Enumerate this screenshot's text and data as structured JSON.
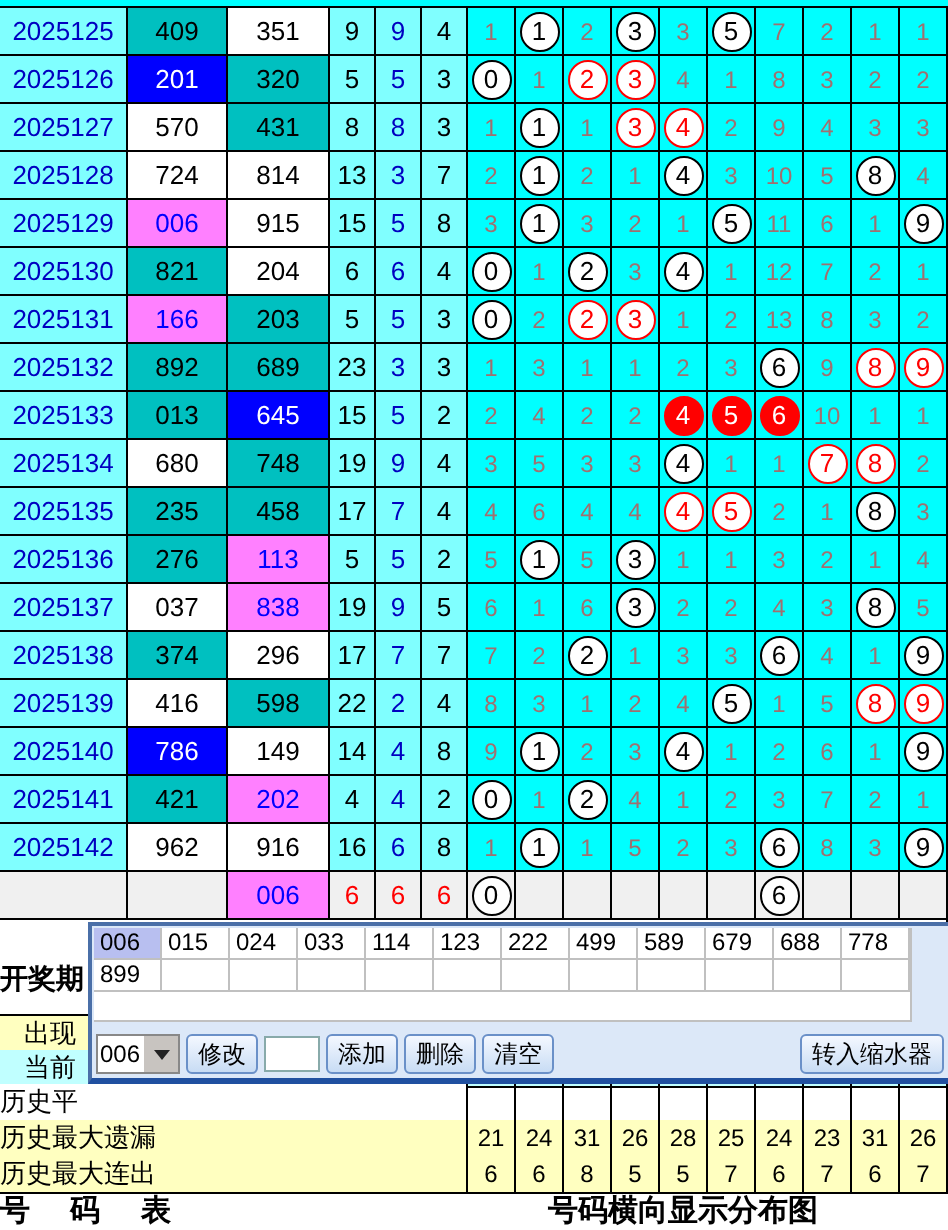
{
  "draws": [
    {
      "period": "2025125",
      "number_1": {
        "text": "409",
        "color": "#00c0c0"
      },
      "number_2": {
        "text": "351",
        "color": "#ffffff"
      },
      "sum": "9",
      "sum_tail": "9",
      "span": "4",
      "digits": [
        {
          "text": "1",
          "kind": "miss"
        },
        {
          "text": "1",
          "kind": "ball"
        },
        {
          "text": "2",
          "kind": "miss"
        },
        {
          "text": "3",
          "kind": "ball"
        },
        {
          "text": "3",
          "kind": "miss"
        },
        {
          "text": "5",
          "kind": "ball"
        },
        {
          "text": "7",
          "kind": "miss"
        },
        {
          "text": "2",
          "kind": "miss"
        },
        {
          "text": "1",
          "kind": "miss"
        },
        {
          "text": "1",
          "kind": "miss"
        }
      ]
    },
    {
      "period": "2025126",
      "number_1": {
        "text": "201",
        "color": "#0000ff"
      },
      "number_2": {
        "text": "320",
        "color": "#00c0c0"
      },
      "sum": "5",
      "sum_tail": "5",
      "span": "3",
      "digits": [
        {
          "text": "0",
          "kind": "ball"
        },
        {
          "text": "1",
          "kind": "miss"
        },
        {
          "text": "2",
          "kind": "ring"
        },
        {
          "text": "3",
          "kind": "ring"
        },
        {
          "text": "4",
          "kind": "miss"
        },
        {
          "text": "1",
          "kind": "miss"
        },
        {
          "text": "8",
          "kind": "miss"
        },
        {
          "text": "3",
          "kind": "miss"
        },
        {
          "text": "2",
          "kind": "miss"
        },
        {
          "text": "2",
          "kind": "miss"
        }
      ]
    },
    {
      "period": "2025127",
      "number_1": {
        "text": "570",
        "color": "#ffffff"
      },
      "number_2": {
        "text": "431",
        "color": "#00c0c0"
      },
      "sum": "8",
      "sum_tail": "8",
      "span": "3",
      "digits": [
        {
          "text": "1",
          "kind": "miss"
        },
        {
          "text": "1",
          "kind": "ball"
        },
        {
          "text": "1",
          "kind": "miss"
        },
        {
          "text": "3",
          "kind": "ring"
        },
        {
          "text": "4",
          "kind": "ring"
        },
        {
          "text": "2",
          "kind": "miss"
        },
        {
          "text": "9",
          "kind": "miss"
        },
        {
          "text": "4",
          "kind": "miss"
        },
        {
          "text": "3",
          "kind": "miss"
        },
        {
          "text": "3",
          "kind": "miss"
        }
      ]
    },
    {
      "period": "2025128",
      "number_1": {
        "text": "724",
        "color": "#ffffff"
      },
      "number_2": {
        "text": "814",
        "color": "#ffffff"
      },
      "sum": "13",
      "sum_tail": "3",
      "span": "7",
      "digits": [
        {
          "text": "2",
          "kind": "miss"
        },
        {
          "text": "1",
          "kind": "ball"
        },
        {
          "text": "2",
          "kind": "miss"
        },
        {
          "text": "1",
          "kind": "miss"
        },
        {
          "text": "4",
          "kind": "ball"
        },
        {
          "text": "3",
          "kind": "miss"
        },
        {
          "text": "10",
          "kind": "miss"
        },
        {
          "text": "5",
          "kind": "miss"
        },
        {
          "text": "8",
          "kind": "ball"
        },
        {
          "text": "4",
          "kind": "miss"
        }
      ]
    },
    {
      "period": "2025129",
      "number_1": {
        "text": "006",
        "color": "#ff80ff"
      },
      "number_2": {
        "text": "915",
        "color": "#ffffff"
      },
      "sum": "15",
      "sum_tail": "5",
      "span": "8",
      "digits": [
        {
          "text": "3",
          "kind": "miss"
        },
        {
          "text": "1",
          "kind": "ball"
        },
        {
          "text": "3",
          "kind": "miss"
        },
        {
          "text": "2",
          "kind": "miss"
        },
        {
          "text": "1",
          "kind": "miss"
        },
        {
          "text": "5",
          "kind": "ball"
        },
        {
          "text": "11",
          "kind": "miss"
        },
        {
          "text": "6",
          "kind": "miss"
        },
        {
          "text": "1",
          "kind": "miss"
        },
        {
          "text": "9",
          "kind": "ball"
        }
      ]
    },
    {
      "period": "2025130",
      "number_1": {
        "text": "821",
        "color": "#00c0c0"
      },
      "number_2": {
        "text": "204",
        "color": "#ffffff"
      },
      "sum": "6",
      "sum_tail": "6",
      "span": "4",
      "digits": [
        {
          "text": "0",
          "kind": "ball"
        },
        {
          "text": "1",
          "kind": "miss"
        },
        {
          "text": "2",
          "kind": "ball"
        },
        {
          "text": "3",
          "kind": "miss"
        },
        {
          "text": "4",
          "kind": "ball"
        },
        {
          "text": "1",
          "kind": "miss"
        },
        {
          "text": "12",
          "kind": "miss"
        },
        {
          "text": "7",
          "kind": "miss"
        },
        {
          "text": "2",
          "kind": "miss"
        },
        {
          "text": "1",
          "kind": "miss"
        }
      ]
    },
    {
      "period": "2025131",
      "number_1": {
        "text": "166",
        "color": "#ff80ff"
      },
      "number_2": {
        "text": "203",
        "color": "#00c0c0"
      },
      "sum": "5",
      "sum_tail": "5",
      "span": "3",
      "digits": [
        {
          "text": "0",
          "kind": "ball"
        },
        {
          "text": "2",
          "kind": "miss"
        },
        {
          "text": "2",
          "kind": "ring"
        },
        {
          "text": "3",
          "kind": "ring"
        },
        {
          "text": "1",
          "kind": "miss"
        },
        {
          "text": "2",
          "kind": "miss"
        },
        {
          "text": "13",
          "kind": "miss"
        },
        {
          "text": "8",
          "kind": "miss"
        },
        {
          "text": "3",
          "kind": "miss"
        },
        {
          "text": "2",
          "kind": "miss"
        }
      ]
    },
    {
      "period": "2025132",
      "number_1": {
        "text": "892",
        "color": "#00c0c0"
      },
      "number_2": {
        "text": "689",
        "color": "#00c0c0"
      },
      "sum": "23",
      "sum_tail": "3",
      "span": "3",
      "digits": [
        {
          "text": "1",
          "kind": "miss"
        },
        {
          "text": "3",
          "kind": "miss"
        },
        {
          "text": "1",
          "kind": "miss"
        },
        {
          "text": "1",
          "kind": "miss"
        },
        {
          "text": "2",
          "kind": "miss"
        },
        {
          "text": "3",
          "kind": "miss"
        },
        {
          "text": "6",
          "kind": "ball"
        },
        {
          "text": "9",
          "kind": "miss"
        },
        {
          "text": "8",
          "kind": "ring"
        },
        {
          "text": "9",
          "kind": "ring"
        }
      ]
    },
    {
      "period": "2025133",
      "number_1": {
        "text": "013",
        "color": "#00c0c0"
      },
      "number_2": {
        "text": "645",
        "color": "#0000ff"
      },
      "sum": "15",
      "sum_tail": "5",
      "span": "2",
      "digits": [
        {
          "text": "2",
          "kind": "miss"
        },
        {
          "text": "4",
          "kind": "miss"
        },
        {
          "text": "2",
          "kind": "miss"
        },
        {
          "text": "2",
          "kind": "miss"
        },
        {
          "text": "4",
          "kind": "hot"
        },
        {
          "text": "5",
          "kind": "hot"
        },
        {
          "text": "6",
          "kind": "hot"
        },
        {
          "text": "10",
          "kind": "miss"
        },
        {
          "text": "1",
          "kind": "miss"
        },
        {
          "text": "1",
          "kind": "miss"
        }
      ]
    },
    {
      "period": "2025134",
      "number_1": {
        "text": "680",
        "color": "#ffffff"
      },
      "number_2": {
        "text": "748",
        "color": "#00c0c0"
      },
      "sum": "19",
      "sum_tail": "9",
      "span": "4",
      "digits": [
        {
          "text": "3",
          "kind": "miss"
        },
        {
          "text": "5",
          "kind": "miss"
        },
        {
          "text": "3",
          "kind": "miss"
        },
        {
          "text": "3",
          "kind": "miss"
        },
        {
          "text": "4",
          "kind": "ball"
        },
        {
          "text": "1",
          "kind": "miss"
        },
        {
          "text": "1",
          "kind": "miss"
        },
        {
          "text": "7",
          "kind": "ring"
        },
        {
          "text": "8",
          "kind": "ring"
        },
        {
          "text": "2",
          "kind": "miss"
        }
      ]
    },
    {
      "period": "2025135",
      "number_1": {
        "text": "235",
        "color": "#00c0c0"
      },
      "number_2": {
        "text": "458",
        "color": "#00c0c0"
      },
      "sum": "17",
      "sum_tail": "7",
      "span": "4",
      "digits": [
        {
          "text": "4",
          "kind": "miss"
        },
        {
          "text": "6",
          "kind": "miss"
        },
        {
          "text": "4",
          "kind": "miss"
        },
        {
          "text": "4",
          "kind": "miss"
        },
        {
          "text": "4",
          "kind": "ring"
        },
        {
          "text": "5",
          "kind": "ring"
        },
        {
          "text": "2",
          "kind": "miss"
        },
        {
          "text": "1",
          "kind": "miss"
        },
        {
          "text": "8",
          "kind": "ball"
        },
        {
          "text": "3",
          "kind": "miss"
        }
      ]
    },
    {
      "period": "2025136",
      "number_1": {
        "text": "276",
        "color": "#00c0c0"
      },
      "number_2": {
        "text": "113",
        "color": "#ff80ff"
      },
      "sum": "5",
      "sum_tail": "5",
      "span": "2",
      "digits": [
        {
          "text": "5",
          "kind": "miss"
        },
        {
          "text": "1",
          "kind": "ball"
        },
        {
          "text": "5",
          "kind": "miss"
        },
        {
          "text": "3",
          "kind": "ball"
        },
        {
          "text": "1",
          "kind": "miss"
        },
        {
          "text": "1",
          "kind": "miss"
        },
        {
          "text": "3",
          "kind": "miss"
        },
        {
          "text": "2",
          "kind": "miss"
        },
        {
          "text": "1",
          "kind": "miss"
        },
        {
          "text": "4",
          "kind": "miss"
        }
      ]
    },
    {
      "period": "2025137",
      "number_1": {
        "text": "037",
        "color": "#ffffff"
      },
      "number_2": {
        "text": "838",
        "color": "#ff80ff"
      },
      "sum": "19",
      "sum_tail": "9",
      "span": "5",
      "digits": [
        {
          "text": "6",
          "kind": "miss"
        },
        {
          "text": "1",
          "kind": "miss"
        },
        {
          "text": "6",
          "kind": "miss"
        },
        {
          "text": "3",
          "kind": "ball"
        },
        {
          "text": "2",
          "kind": "miss"
        },
        {
          "text": "2",
          "kind": "miss"
        },
        {
          "text": "4",
          "kind": "miss"
        },
        {
          "text": "3",
          "kind": "miss"
        },
        {
          "text": "8",
          "kind": "ball"
        },
        {
          "text": "5",
          "kind": "miss"
        }
      ]
    },
    {
      "period": "2025138",
      "number_1": {
        "text": "374",
        "color": "#00c0c0"
      },
      "number_2": {
        "text": "296",
        "color": "#ffffff"
      },
      "sum": "17",
      "sum_tail": "7",
      "span": "7",
      "digits": [
        {
          "text": "7",
          "kind": "miss"
        },
        {
          "text": "2",
          "kind": "miss"
        },
        {
          "text": "2",
          "kind": "ball"
        },
        {
          "text": "1",
          "kind": "miss"
        },
        {
          "text": "3",
          "kind": "miss"
        },
        {
          "text": "3",
          "kind": "miss"
        },
        {
          "text": "6",
          "kind": "ball"
        },
        {
          "text": "4",
          "kind": "miss"
        },
        {
          "text": "1",
          "kind": "miss"
        },
        {
          "text": "9",
          "kind": "ball"
        }
      ]
    },
    {
      "period": "2025139",
      "number_1": {
        "text": "416",
        "color": "#ffffff"
      },
      "number_2": {
        "text": "598",
        "color": "#00c0c0"
      },
      "sum": "22",
      "sum_tail": "2",
      "span": "4",
      "digits": [
        {
          "text": "8",
          "kind": "miss"
        },
        {
          "text": "3",
          "kind": "miss"
        },
        {
          "text": "1",
          "kind": "miss"
        },
        {
          "text": "2",
          "kind": "miss"
        },
        {
          "text": "4",
          "kind": "miss"
        },
        {
          "text": "5",
          "kind": "ball"
        },
        {
          "text": "1",
          "kind": "miss"
        },
        {
          "text": "5",
          "kind": "miss"
        },
        {
          "text": "8",
          "kind": "ring"
        },
        {
          "text": "9",
          "kind": "ring"
        }
      ]
    },
    {
      "period": "2025140",
      "number_1": {
        "text": "786",
        "color": "#0000ff"
      },
      "number_2": {
        "text": "149",
        "color": "#ffffff"
      },
      "sum": "14",
      "sum_tail": "4",
      "span": "8",
      "digits": [
        {
          "text": "9",
          "kind": "miss"
        },
        {
          "text": "1",
          "kind": "ball"
        },
        {
          "text": "2",
          "kind": "miss"
        },
        {
          "text": "3",
          "kind": "miss"
        },
        {
          "text": "4",
          "kind": "ball"
        },
        {
          "text": "1",
          "kind": "miss"
        },
        {
          "text": "2",
          "kind": "miss"
        },
        {
          "text": "6",
          "kind": "miss"
        },
        {
          "text": "1",
          "kind": "miss"
        },
        {
          "text": "9",
          "kind": "ball"
        }
      ]
    },
    {
      "period": "2025141",
      "number_1": {
        "text": "421",
        "color": "#00c0c0"
      },
      "number_2": {
        "text": "202",
        "color": "#ff80ff"
      },
      "sum": "4",
      "sum_tail": "4",
      "span": "2",
      "digits": [
        {
          "text": "0",
          "kind": "ball"
        },
        {
          "text": "1",
          "kind": "miss"
        },
        {
          "text": "2",
          "kind": "ball"
        },
        {
          "text": "4",
          "kind": "miss"
        },
        {
          "text": "1",
          "kind": "miss"
        },
        {
          "text": "2",
          "kind": "miss"
        },
        {
          "text": "3",
          "kind": "miss"
        },
        {
          "text": "7",
          "kind": "miss"
        },
        {
          "text": "2",
          "kind": "miss"
        },
        {
          "text": "1",
          "kind": "miss"
        }
      ]
    },
    {
      "period": "2025142",
      "number_1": {
        "text": "962",
        "color": "#ffffff"
      },
      "number_2": {
        "text": "916",
        "color": "#ffffff"
      },
      "sum": "16",
      "sum_tail": "6",
      "span": "8",
      "digits": [
        {
          "text": "1",
          "kind": "miss"
        },
        {
          "text": "1",
          "kind": "ball"
        },
        {
          "text": "1",
          "kind": "miss"
        },
        {
          "text": "5",
          "kind": "miss"
        },
        {
          "text": "2",
          "kind": "miss"
        },
        {
          "text": "3",
          "kind": "miss"
        },
        {
          "text": "6",
          "kind": "ball"
        },
        {
          "text": "8",
          "kind": "miss"
        },
        {
          "text": "3",
          "kind": "miss"
        },
        {
          "text": "9",
          "kind": "ball"
        }
      ]
    }
  ],
  "summary": {
    "number_2": {
      "text": "006",
      "color": "#ff80ff"
    },
    "sum": "6",
    "sum_tail": "6",
    "span": "6",
    "digits": [
      {
        "text": "0",
        "kind": "ball"
      },
      {
        "kind": "empty"
      },
      {
        "kind": "empty"
      },
      {
        "kind": "empty"
      },
      {
        "kind": "empty"
      },
      {
        "kind": "empty"
      },
      {
        "text": "6",
        "kind": "ball"
      },
      {
        "kind": "empty"
      },
      {
        "kind": "empty"
      },
      {
        "kind": "empty"
      }
    ]
  },
  "stats_rows": [
    {
      "label": "开奖期",
      "kind": "header"
    },
    {
      "label": "出现",
      "kind": "indented",
      "color": "#ffffc0"
    },
    {
      "label": "当前",
      "kind": "indented",
      "color": "#c0ffff"
    },
    {
      "label": "历史平",
      "kind": "plain",
      "color": "#ffffff",
      "values": []
    },
    {
      "label": "历史最大遗漏",
      "kind": "plain",
      "color": "#ffffc0",
      "values": [
        "21",
        "24",
        "31",
        "26",
        "28",
        "25",
        "24",
        "23",
        "31",
        "26"
      ]
    },
    {
      "label": "历史最大连出",
      "kind": "plain",
      "color": "#ffffc0",
      "values": [
        "6",
        "6",
        "8",
        "5",
        "5",
        "7",
        "6",
        "7",
        "6",
        "7"
      ]
    }
  ],
  "footer": {
    "left_title": "号 码 表",
    "chart_title": "号码横向显示分布图"
  },
  "popup": {
    "codes": [
      {
        "text": "006",
        "selected": true
      },
      {
        "text": "015",
        "selected": false
      },
      {
        "text": "024",
        "selected": false
      },
      {
        "text": "033",
        "selected": false
      },
      {
        "text": "114",
        "selected": false
      },
      {
        "text": "123",
        "selected": false
      },
      {
        "text": "222",
        "selected": false
      },
      {
        "text": "499",
        "selected": false
      },
      {
        "text": "589",
        "selected": false
      },
      {
        "text": "679",
        "selected": false
      },
      {
        "text": "688",
        "selected": false
      },
      {
        "text": "778",
        "selected": false
      },
      {
        "text": "899",
        "selected": false
      }
    ],
    "selector": {
      "value": "006"
    },
    "edit_button": "修改",
    "buttons": [
      "添加",
      "删除",
      "清空"
    ],
    "transfer_button": "转入缩水器"
  }
}
